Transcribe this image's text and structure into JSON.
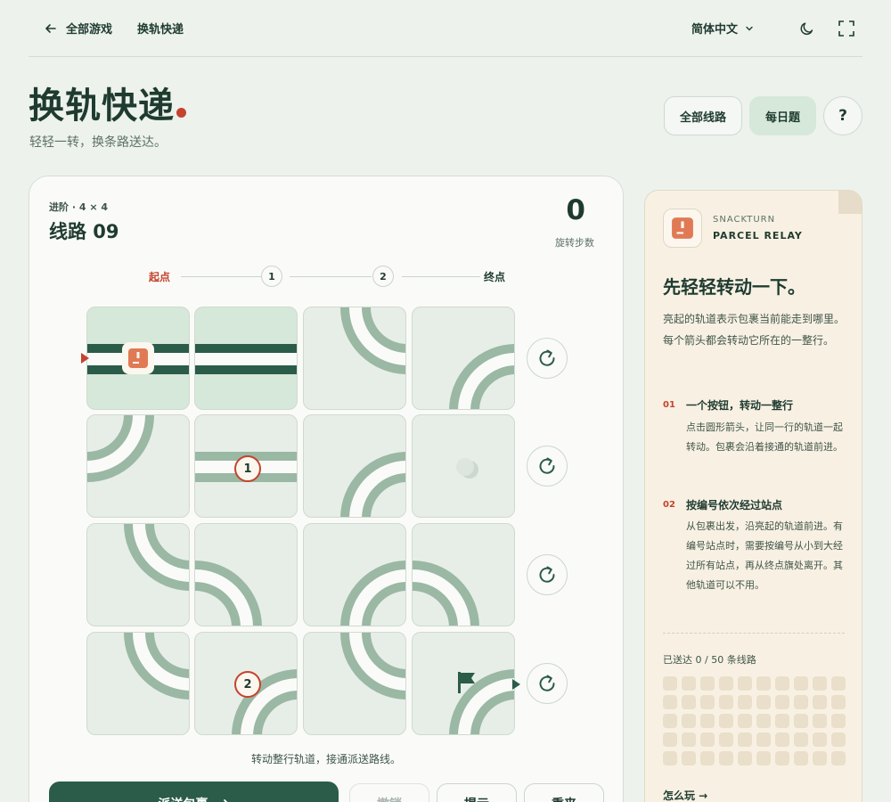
{
  "nav": {
    "back_label": "全部游戏",
    "game_name": "换轨快递",
    "language": "简体中文"
  },
  "header": {
    "title": "换轨快递",
    "subtitle": "轻轻一转，换条路送达。",
    "buttons": {
      "all_routes": "全部线路",
      "daily": "每日题",
      "help": "?"
    }
  },
  "game": {
    "level_tag": "进阶 · 4 × 4",
    "level_name": "线路 09",
    "moves": "0",
    "moves_label": "旋转步数",
    "progress": {
      "start": "起点",
      "stop1": "1",
      "stop2": "2",
      "end": "终点"
    },
    "stations": {
      "s1": "1",
      "s2": "2"
    },
    "hint": "转动整行轨道，接通派送路线。",
    "actions": {
      "dispatch": "派送包裹",
      "undo": "撤销",
      "hint": "提示",
      "restart": "重来"
    }
  },
  "board": {
    "rows": [
      [
        "straight-h-lit",
        "straight-h-lit",
        "curve-top-right",
        "curve-bottom-right"
      ],
      [
        "curve-top-left",
        "straight-h",
        "curve-bottom-right",
        "empty"
      ],
      [
        "curve-top-right",
        "curve-bottom-left",
        "curve-bottom-right",
        "curve-bottom-left"
      ],
      [
        "curve-top-right",
        "curve-bottom-right",
        "curve-top-right",
        "curve-bottom-right"
      ]
    ]
  },
  "side": {
    "brand_top": "SNACKTURN",
    "brand_name": "PARCEL RELAY",
    "title": "先轻轻转动一下。",
    "desc": "亮起的轨道表示包裹当前能走到哪里。每个箭头都会转动它所在的一整行。",
    "steps": [
      {
        "num": "01",
        "title": "一个按钮，转动一整行",
        "body": "点击圆形箭头，让同一行的轨道一起转动。包裹会沿着接通的轨道前进。"
      },
      {
        "num": "02",
        "title": "按编号依次经过站点",
        "body": "从包裹出发，沿亮起的轨道前进。有编号站点时，需要按编号从小到大经过所有站点，再从终点旗处离开。其他轨道可以不用。"
      }
    ],
    "delivered": "已送达 0 / 50 条线路",
    "delivered_count": 0,
    "total_routes": 50,
    "how_to_play": "怎么玩 →"
  },
  "colors": {
    "background": "#edf2ed",
    "track": "#9ab8a4",
    "track_lit": "#2b5c49",
    "accent_red": "#c4432e",
    "parcel": "#e07a55"
  }
}
